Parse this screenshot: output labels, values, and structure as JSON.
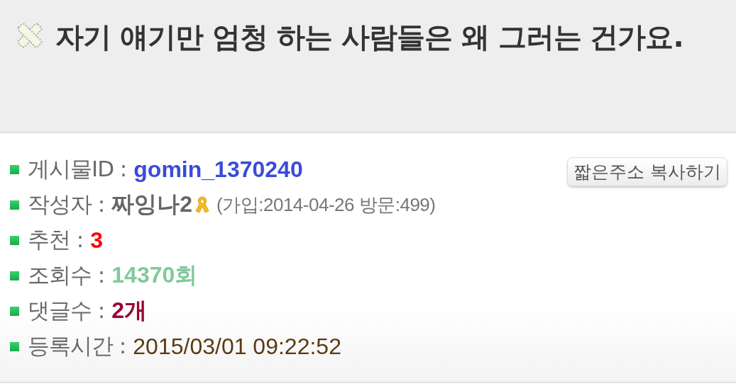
{
  "title": "자기 얘기만 엄청 하는 사람들은 왜 그러는 건가요.",
  "copy_button": "짧은주소 복사하기",
  "rows": [
    {
      "kind": "plain",
      "label": "게시물ID :",
      "value": "gomin_1370240",
      "color": "#3b4bd9",
      "bold": true
    },
    {
      "kind": "author",
      "label": "작성자 :",
      "value": "짜잉나2",
      "color": "#666666",
      "bold": true,
      "note": "(가입:2014-04-26 방문:499)"
    },
    {
      "kind": "plain",
      "label": "추천 :",
      "value": "3",
      "color": "#ff0000",
      "bold": true
    },
    {
      "kind": "plain",
      "label": "조회수 :",
      "value": "14370회",
      "color": "#80c99b",
      "bold": true
    },
    {
      "kind": "plain",
      "label": "댓글수 :",
      "value": "2개",
      "color": "#990033",
      "bold": true
    },
    {
      "kind": "plain",
      "label": "등록시간 :",
      "value": "2015/03/01 09:22:52",
      "color": "#5b3a12",
      "bold": false
    }
  ]
}
